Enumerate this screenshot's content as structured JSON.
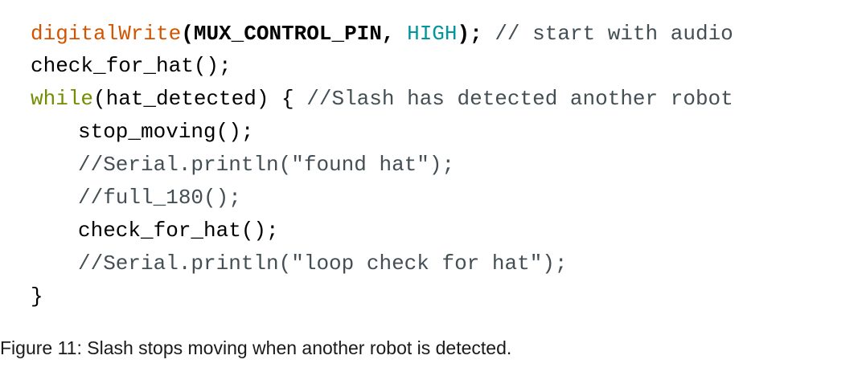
{
  "code": {
    "line1": {
      "func": "digitalWrite",
      "open": "(MUX_CONTROL_PIN, ",
      "const": "HIGH",
      "close": "); ",
      "comment": "// start with audio"
    },
    "line2": {
      "text": "check_for_hat();"
    },
    "line3": {
      "kw": "while",
      "rest": "(hat_detected) { ",
      "comment": "//Slash has detected another robot"
    },
    "line4": {
      "text": "stop_moving();"
    },
    "line5": {
      "comment": "//Serial.println(\"found hat\");"
    },
    "line6": {
      "comment": "//full_180();"
    },
    "line7": {
      "text": "check_for_hat();"
    },
    "line8": {
      "comment": "//Serial.println(\"loop check for hat\");"
    },
    "line9": {
      "text": "}"
    }
  },
  "caption": "Figure 11: Slash stops moving when another robot is detected.",
  "colors": {
    "function": "#d35400",
    "constant": "#00979c",
    "keyword": "#728e00",
    "comment": "#434f54"
  }
}
